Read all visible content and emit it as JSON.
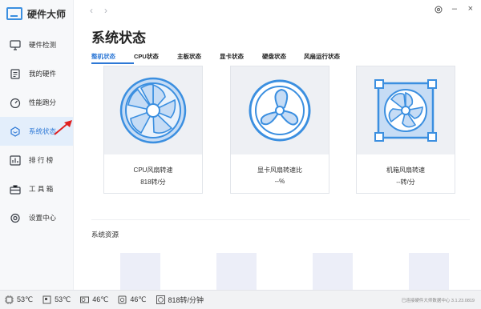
{
  "app": {
    "title": "硬件大师"
  },
  "sidebar": {
    "items": [
      {
        "label": "硬件检测",
        "icon": "monitor-icon",
        "active": false
      },
      {
        "label": "我的硬件",
        "icon": "document-icon",
        "active": false
      },
      {
        "label": "性能跑分",
        "icon": "speedometer-icon",
        "active": false
      },
      {
        "label": "系统状态",
        "icon": "hexagon-status-icon",
        "active": true
      },
      {
        "label": "排 行 榜",
        "icon": "ranking-icon",
        "active": false
      },
      {
        "label": "工 具 箱",
        "icon": "toolbox-icon",
        "active": false
      },
      {
        "label": "设置中心",
        "icon": "gear-icon",
        "active": false
      }
    ]
  },
  "page": {
    "title": "系统状态"
  },
  "tabs": [
    {
      "label": "整机状态",
      "active": true
    },
    {
      "label": "CPU状态",
      "active": false
    },
    {
      "label": "主板状态",
      "active": false
    },
    {
      "label": "显卡状态",
      "active": false
    },
    {
      "label": "硬盘状态",
      "active": false
    },
    {
      "label": "风扇运行状态",
      "active": false
    }
  ],
  "cards": [
    {
      "label": "CPU风扇转速",
      "value": "818转/分",
      "icon": "cpu-fan-icon"
    },
    {
      "label": "显卡风扇转速比",
      "value": "--%",
      "icon": "gpu-fan-icon"
    },
    {
      "label": "机箱风扇转速",
      "value": "--转/分",
      "icon": "case-fan-icon"
    }
  ],
  "resources": {
    "title": "系统资源"
  },
  "status": {
    "items": [
      {
        "value": "53℃",
        "icon": "cpu-temp-icon"
      },
      {
        "value": "53℃",
        "icon": "motherboard-temp-icon"
      },
      {
        "value": "46℃",
        "icon": "gpu-temp-icon"
      },
      {
        "value": "46℃",
        "icon": "disk-temp-icon"
      },
      {
        "value": "818转/分钟",
        "icon": "fan-speed-icon"
      }
    ],
    "right_text": "已连接硬件大师数据中心   3.1.23.0819"
  },
  "colors": {
    "accent": "#2d78d6",
    "icon_blue": "#3b8fe0",
    "fan_fill": "#c6dcf5"
  }
}
